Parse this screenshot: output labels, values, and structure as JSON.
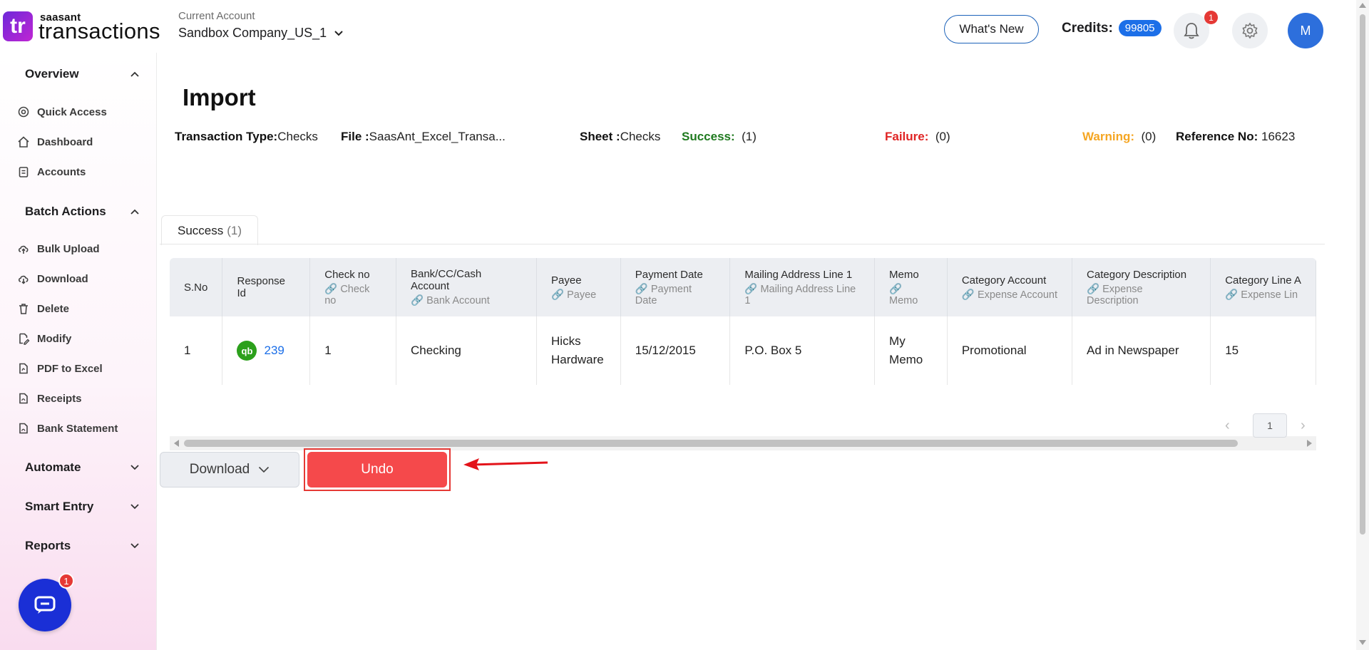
{
  "header": {
    "logo_text": "tr",
    "brand_small": "saasant",
    "brand_big": "transactions",
    "account_label": "Current Account",
    "account_value": "Sandbox Company_US_1",
    "whats_new": "What's New",
    "credits_label": "Credits:",
    "credits_value": "99805",
    "notification_count": "1",
    "avatar_initial": "M"
  },
  "sidebar": {
    "sections": [
      {
        "label": "Overview",
        "items": [
          "Quick Access",
          "Dashboard",
          "Accounts"
        ]
      },
      {
        "label": "Batch Actions",
        "items": [
          "Bulk Upload",
          "Download",
          "Delete",
          "Modify",
          "PDF to Excel",
          "Receipts",
          "Bank Statement"
        ]
      },
      {
        "label": "Automate"
      },
      {
        "label": "Smart Entry"
      },
      {
        "label": "Reports"
      }
    ],
    "chat_badge": "1"
  },
  "main": {
    "title": "Import",
    "meta": {
      "transaction_type_label": "Transaction Type:",
      "transaction_type_value": "Checks",
      "file_label": "File :",
      "file_value": "SaasAnt_Excel_Transa...",
      "sheet_label": "Sheet :",
      "sheet_value": "Checks",
      "success_label": "Success:",
      "success_value": "(1)",
      "failure_label": "Failure:",
      "failure_value": "(0)",
      "warning_label": "Warning:",
      "warning_value": "(0)",
      "reference_label": "Reference No:",
      "reference_value": "16623"
    },
    "tab": {
      "label": "Success",
      "count": "(1)"
    },
    "table": {
      "columns": [
        {
          "title": "S.No",
          "sub": ""
        },
        {
          "title": "Response Id",
          "sub": ""
        },
        {
          "title": "Check no",
          "sub": "Check no"
        },
        {
          "title": "Bank/CC/Cash Account",
          "sub": "Bank Account"
        },
        {
          "title": "Payee",
          "sub": "Payee"
        },
        {
          "title": "Payment Date",
          "sub": "Payment Date"
        },
        {
          "title": "Mailing Address Line 1",
          "sub": "Mailing Address Line 1"
        },
        {
          "title": "Memo",
          "sub": "Memo"
        },
        {
          "title": "Category Account",
          "sub": "Expense Account"
        },
        {
          "title": "Category Description",
          "sub": "Expense Description"
        },
        {
          "title": "Category Line A",
          "sub": "Expense Lin"
        }
      ],
      "row": {
        "sno": "1",
        "qb_icon": "qb",
        "response_id": "239",
        "check_no": "1",
        "bank_account": "Checking",
        "payee": "Hicks Hardware",
        "payment_date": "15/12/2015",
        "mailing_address": "P.O. Box 5",
        "memo": "My Memo",
        "category_account": "Promotional",
        "category_description": "Ad in Newspaper",
        "category_line": "15"
      }
    },
    "pager": {
      "current": "1"
    },
    "download_label": "Download",
    "undo_label": "Undo"
  },
  "colors": {
    "accent": "#1c6fe8",
    "undo": "#f5494b",
    "success": "#1f7a1f",
    "failure": "#e02424",
    "warning": "#f5a623"
  }
}
